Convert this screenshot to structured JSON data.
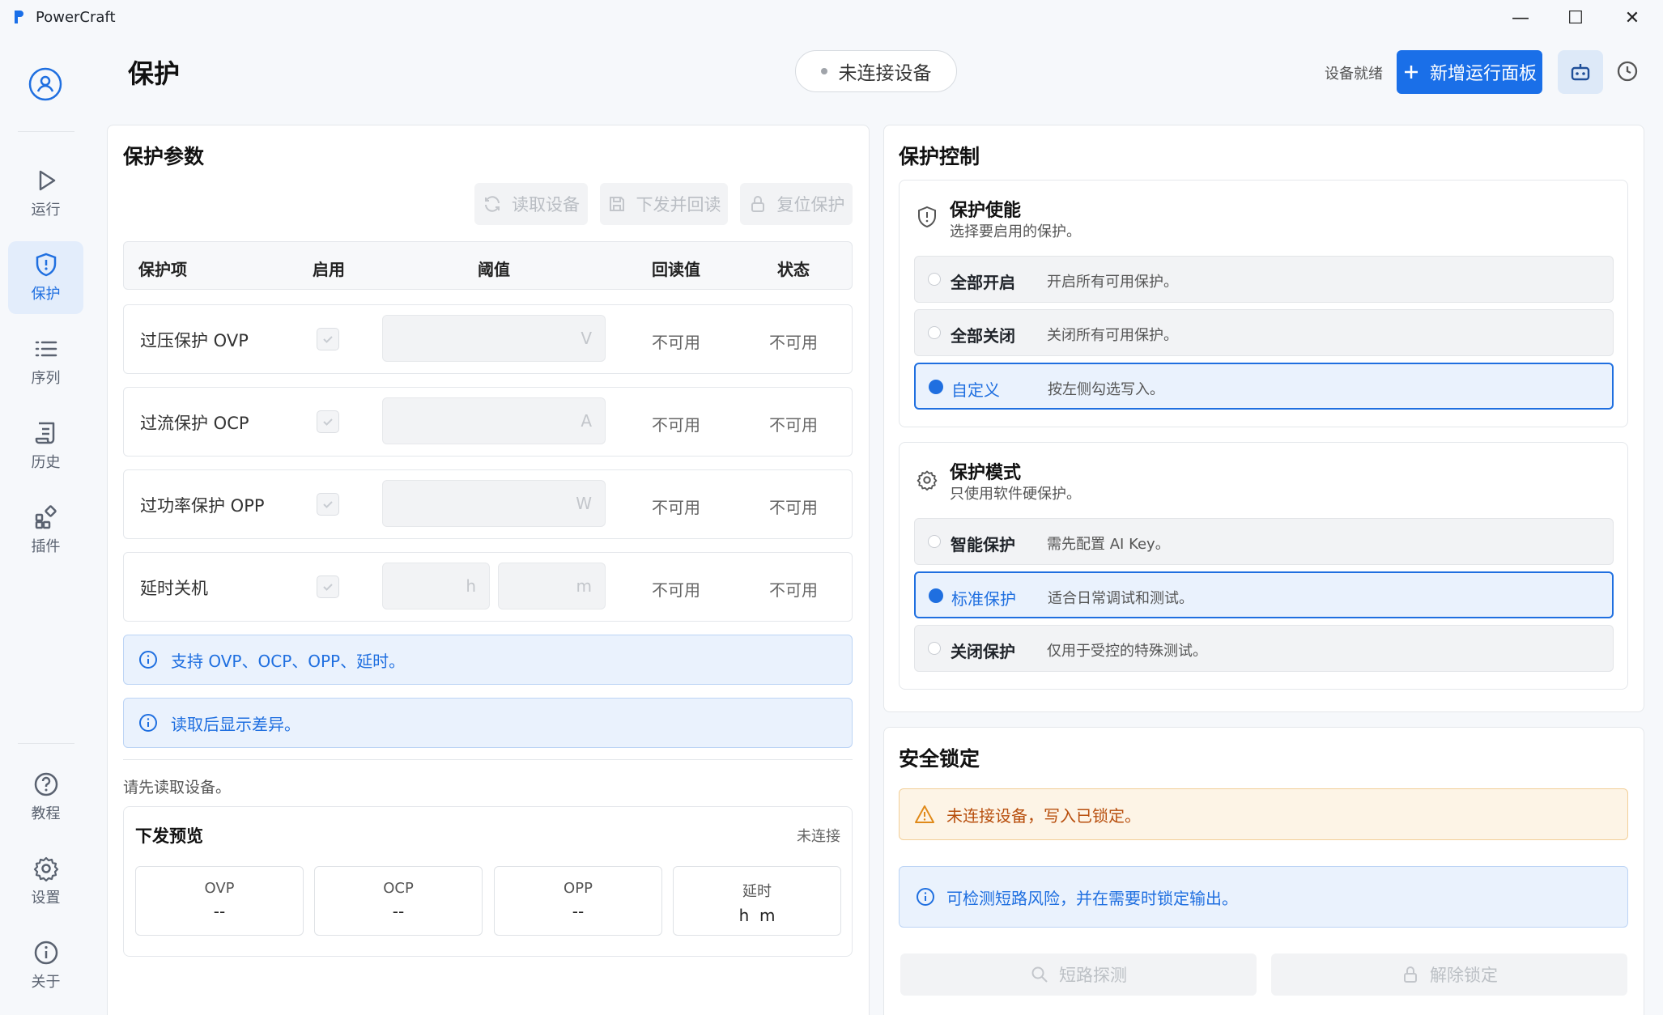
{
  "window": {
    "app_title": "PowerCraft",
    "minimize": "—",
    "maximize": "☐",
    "close": "✕"
  },
  "sidebar": {
    "items": [
      {
        "label": "运行"
      },
      {
        "label": "保护"
      },
      {
        "label": "序列"
      },
      {
        "label": "历史"
      },
      {
        "label": "插件"
      },
      {
        "label": "教程"
      },
      {
        "label": "设置"
      },
      {
        "label": "关于"
      }
    ]
  },
  "header": {
    "title": "保护",
    "connection_status": "未连接设备",
    "device_ready": "设备就绪",
    "add_panel_label": "新增运行面板"
  },
  "params": {
    "title": "保护参数",
    "toolbar": {
      "read": "读取设备",
      "apply": "下发并回读",
      "reset": "复位保护"
    },
    "columns": [
      "保护项",
      "启用",
      "阈值",
      "回读值",
      "状态"
    ],
    "rows": [
      {
        "name": "过压保护 OVP",
        "unit": "V",
        "readback": "不可用",
        "status": "不可用"
      },
      {
        "name": "过流保护 OCP",
        "unit": "A",
        "readback": "不可用",
        "status": "不可用"
      },
      {
        "name": "过功率保护 OPP",
        "unit": "W",
        "readback": "不可用",
        "status": "不可用"
      },
      {
        "name": "延时关机",
        "unit_h": "h",
        "unit_m": "m",
        "readback": "不可用",
        "status": "不可用"
      }
    ],
    "info1": "支持 OVP、OCP、OPP、延时。",
    "info2": "读取后显示差异。",
    "hint": "请先读取设备。",
    "preview": {
      "title": "下发预览",
      "status": "未连接",
      "cells": [
        {
          "label": "OVP",
          "value": "--"
        },
        {
          "label": "OCP",
          "value": "--"
        },
        {
          "label": "OPP",
          "value": "--"
        },
        {
          "label": "延时",
          "value": "h  m"
        }
      ]
    }
  },
  "control": {
    "title": "保护控制",
    "enable": {
      "title": "保护使能",
      "desc": "选择要启用的保护。",
      "options": [
        {
          "label": "全部开启",
          "desc": "开启所有可用保护。",
          "selected": false
        },
        {
          "label": "全部关闭",
          "desc": "关闭所有可用保护。",
          "selected": false
        },
        {
          "label": "自定义",
          "desc": "按左侧勾选写入。",
          "selected": true
        }
      ]
    },
    "mode": {
      "title": "保护模式",
      "desc": "只使用软件硬保护。",
      "options": [
        {
          "label": "智能保护",
          "desc": "需先配置 AI Key。",
          "selected": false
        },
        {
          "label": "标准保护",
          "desc": "适合日常调试和测试。",
          "selected": true
        },
        {
          "label": "关闭保护",
          "desc": "仅用于受控的特殊测试。",
          "selected": false
        }
      ]
    }
  },
  "lock": {
    "title": "安全锁定",
    "warning": "未连接设备，写入已锁定。",
    "info": "可检测短路风险，并在需要时锁定输出。",
    "detect_btn": "短路探测",
    "unlock_btn": "解除锁定"
  },
  "colors": {
    "accent": "#1a6fe8",
    "warning": "#b84f0e",
    "info_bg": "#eaf2fd"
  }
}
